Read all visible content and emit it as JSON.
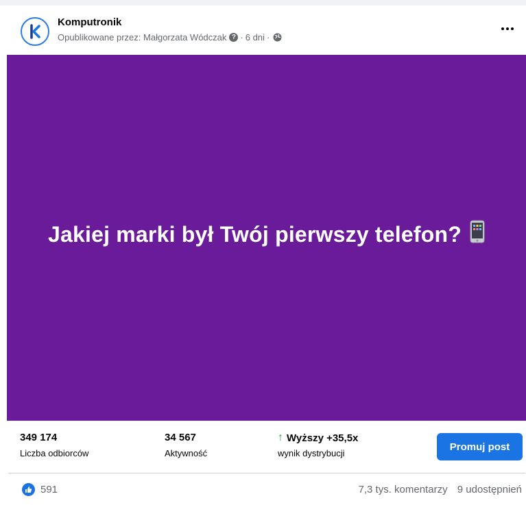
{
  "post": {
    "page_name": "Komputronik",
    "published_by": "Opublikowane przez: Małgorzata Wódczak",
    "help_glyph": "?",
    "time_ago": "6 dni",
    "separator": "·",
    "image_text": "Jakiej marki był Twój pierwszy telefon?",
    "image_bg_color": "#6a1b9a"
  },
  "stats": {
    "reach_value": "349 174",
    "reach_label": "Liczba odbiorców",
    "engagement_value": "34 567",
    "engagement_label": "Aktywność",
    "distribution_arrow": "↑",
    "distribution_value": "Wyższy +35,5x",
    "distribution_label": "wynik dystrybucji",
    "promote_label": "Promuj post"
  },
  "reactions": {
    "like_count": "591",
    "comments": "7,3 tys. komentarzy",
    "shares": "9 udostępnień"
  },
  "icons": {
    "avatar": "komputronik-logo-icon",
    "help": "question-icon",
    "audience": "globe-icon",
    "more": "more-options-icon",
    "phone": "mobile-phone-icon",
    "like": "like-icon",
    "arrow": "arrow-up-icon"
  },
  "colors": {
    "accent": "#1b74e4",
    "positive": "#31a24c",
    "logo_blue": "#2a7be4"
  }
}
